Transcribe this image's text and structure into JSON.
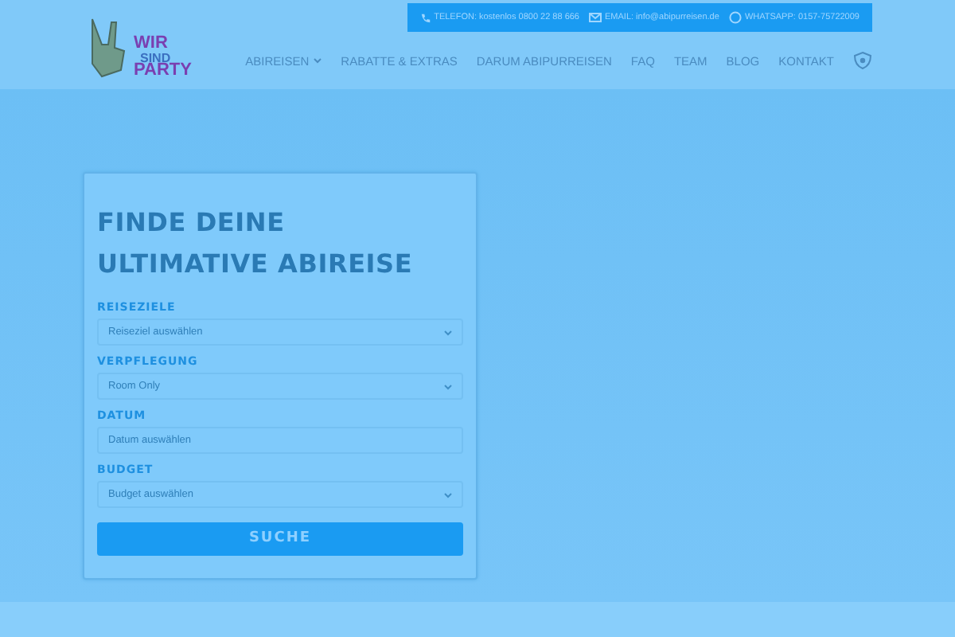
{
  "logo": {
    "lines": [
      "WIR",
      "SIND",
      "PARTY"
    ]
  },
  "contact_bar": [
    {
      "kind": "phone",
      "text": "TELEFON: kostenlos 0800 22 88 666"
    },
    {
      "kind": "mail",
      "text": "EMAIL: info@abipurreisen.de"
    },
    {
      "kind": "whatsapp",
      "text": "WHATSAPP: 0157-75722009"
    }
  ],
  "nav": [
    {
      "label": "ABIREISEN",
      "dropdown": true
    },
    {
      "label": "RABATTE & EXTRAS",
      "dropdown": false
    },
    {
      "label": "DARUM ABIPURREISEN",
      "dropdown": false
    },
    {
      "label": "FAQ",
      "dropdown": false
    },
    {
      "label": "TEAM",
      "dropdown": false
    },
    {
      "label": "BLOG",
      "dropdown": false
    },
    {
      "label": "KONTAKT",
      "dropdown": false
    }
  ],
  "search": {
    "title": "FINDE DEINE ULTIMATIVE ABIREISE",
    "fields": [
      {
        "label": "REISEZIELE",
        "kind": "select",
        "placeholder": "Reiseziel auswählen"
      },
      {
        "label": "VERPFLEGUNG",
        "kind": "select",
        "placeholder": "Room Only"
      },
      {
        "label": "DATUM",
        "kind": "input",
        "placeholder": "Datum auswählen"
      },
      {
        "label": "BUDGET",
        "kind": "select",
        "placeholder": "Budget auswählen"
      }
    ],
    "button": "SUCHE"
  }
}
